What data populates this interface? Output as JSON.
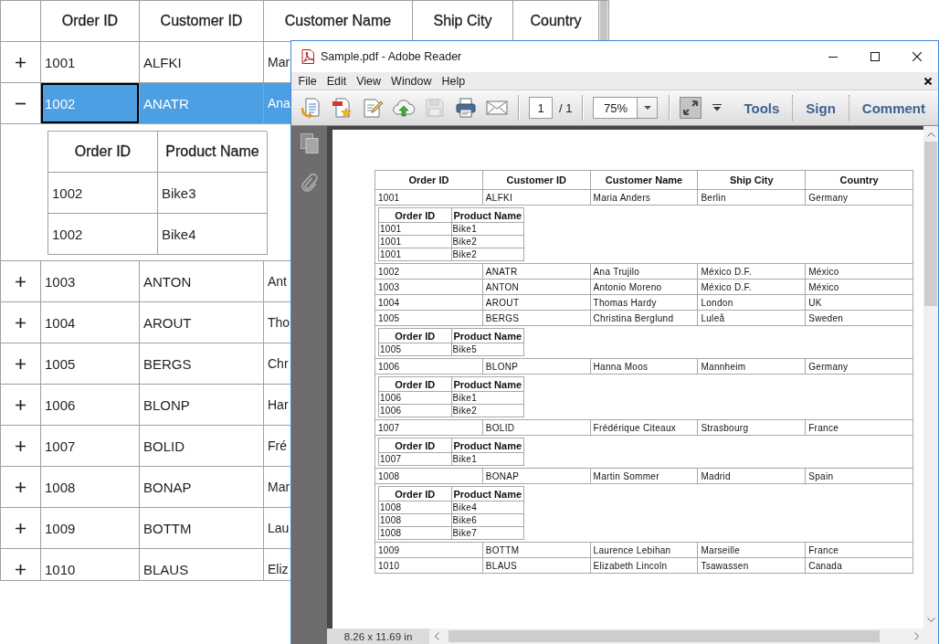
{
  "grid": {
    "columns": [
      "Order ID",
      "Customer ID",
      "Customer Name",
      "Ship City",
      "Country"
    ],
    "rows": [
      {
        "expanded": false,
        "selected": false,
        "cells": [
          {
            "text": "1001",
            "focused": false
          },
          {
            "text": "ALFKI",
            "focused": false
          },
          {
            "text": "Mar",
            "focused": false
          }
        ]
      },
      {
        "expanded": true,
        "selected": true,
        "cells": [
          {
            "text": "1002",
            "focused": true
          },
          {
            "text": "ANATR",
            "focused": false
          },
          {
            "text": "Ana",
            "focused": false
          }
        ],
        "details": {
          "columns": [
            "Order ID",
            "Product Name"
          ],
          "rows": [
            [
              "1002",
              "Bike3"
            ],
            [
              "1002",
              "Bike4"
            ]
          ]
        }
      },
      {
        "expanded": false,
        "selected": false,
        "cells": [
          {
            "text": "1003",
            "focused": false
          },
          {
            "text": "ANTON",
            "focused": false
          },
          {
            "text": "Ant",
            "focused": false
          }
        ]
      },
      {
        "expanded": false,
        "selected": false,
        "cells": [
          {
            "text": "1004",
            "focused": false
          },
          {
            "text": "AROUT",
            "focused": false
          },
          {
            "text": "Tho",
            "focused": false
          }
        ]
      },
      {
        "expanded": false,
        "selected": false,
        "cells": [
          {
            "text": "1005",
            "focused": false
          },
          {
            "text": "BERGS",
            "focused": false
          },
          {
            "text": "Chr",
            "focused": false
          }
        ]
      },
      {
        "expanded": false,
        "selected": false,
        "cells": [
          {
            "text": "1006",
            "focused": false
          },
          {
            "text": "BLONP",
            "focused": false
          },
          {
            "text": "Har",
            "focused": false
          }
        ]
      },
      {
        "expanded": false,
        "selected": false,
        "cells": [
          {
            "text": "1007",
            "focused": false
          },
          {
            "text": "BOLID",
            "focused": false
          },
          {
            "text": "Fré",
            "focused": false
          }
        ]
      },
      {
        "expanded": false,
        "selected": false,
        "cells": [
          {
            "text": "1008",
            "focused": false
          },
          {
            "text": "BONAP",
            "focused": false
          },
          {
            "text": "Mar",
            "focused": false
          }
        ]
      },
      {
        "expanded": false,
        "selected": false,
        "cells": [
          {
            "text": "1009",
            "focused": false
          },
          {
            "text": "BOTTM",
            "focused": false
          },
          {
            "text": "Lau",
            "focused": false
          }
        ]
      },
      {
        "expanded": false,
        "selected": false,
        "cells": [
          {
            "text": "1010",
            "focused": false
          },
          {
            "text": "BLAUS",
            "focused": false
          },
          {
            "text": "Eliz",
            "focused": false
          }
        ]
      }
    ]
  },
  "reader": {
    "title": "Sample.pdf - Adobe Reader",
    "menu": [
      "File",
      "Edit",
      "View",
      "Window",
      "Help"
    ],
    "toolbar": {
      "buttons": [
        {
          "kind": "open",
          "disabled": false
        },
        {
          "kind": "create",
          "disabled": false
        },
        {
          "kind": "edit",
          "disabled": false
        },
        {
          "kind": "upload",
          "disabled": false
        },
        {
          "kind": "save",
          "disabled": true
        },
        {
          "kind": "print",
          "disabled": false
        },
        {
          "kind": "email",
          "disabled": false
        }
      ],
      "page": "1",
      "page_total": "/ 1",
      "zoom": "75%",
      "panes": [
        "Tools",
        "Sign",
        "Comment"
      ]
    },
    "document": {
      "columns": [
        "Order ID",
        "Customer ID",
        "Customer Name",
        "Ship City",
        "Country"
      ],
      "rows": [
        {
          "cells": [
            "1001",
            "ALFKI",
            "Maria Anders",
            "Berlin",
            "Germany"
          ],
          "details": {
            "columns": [
              "Order ID",
              "Product Name"
            ],
            "rows": [
              [
                "1001",
                "Bike1"
              ],
              [
                "1001",
                "Bike2"
              ],
              [
                "1001",
                "Bike2"
              ]
            ]
          }
        },
        {
          "cells": [
            "1002",
            "ANATR",
            "Ana Trujilo",
            "México D.F.",
            "México"
          ]
        },
        {
          "cells": [
            "1003",
            "ANTON",
            "Antonio Moreno",
            "México D.F.",
            "México"
          ]
        },
        {
          "cells": [
            "1004",
            "AROUT",
            "Thomas Hardy",
            "London",
            "UK"
          ]
        },
        {
          "cells": [
            "1005",
            "BERGS",
            "Christina Berglund",
            "Luleå",
            "Sweden"
          ],
          "details": {
            "columns": [
              "Order ID",
              "Product Name"
            ],
            "rows": [
              [
                "1005",
                "Bike5"
              ]
            ]
          }
        },
        {
          "cells": [
            "1006",
            "BLONP",
            "Hanna Moos",
            "Mannheim",
            "Germany"
          ],
          "details": {
            "columns": [
              "Order ID",
              "Product Name"
            ],
            "rows": [
              [
                "1006",
                "Bike1"
              ],
              [
                "1006",
                "Bike2"
              ]
            ]
          }
        },
        {
          "cells": [
            "1007",
            "BOLID",
            "Frédérique Citeaux",
            "Strasbourg",
            "France"
          ],
          "details": {
            "columns": [
              "Order ID",
              "Product Name"
            ],
            "rows": [
              [
                "1007",
                "Bike1"
              ]
            ]
          }
        },
        {
          "cells": [
            "1008",
            "BONAP",
            "Martin Sommer",
            "Madrid",
            "Spain"
          ],
          "details": {
            "columns": [
              "Order ID",
              "Product Name"
            ],
            "rows": [
              [
                "1008",
                "Bike4"
              ],
              [
                "1008",
                "Bike6"
              ],
              [
                "1008",
                "Bike7"
              ]
            ]
          }
        },
        {
          "cells": [
            "1009",
            "BOTTM",
            "Laurence Lebihan",
            "Marseille",
            "France"
          ]
        },
        {
          "cells": [
            "1010",
            "BLAUS",
            "Elizabeth Lincoln",
            "Tsawassen",
            "Canada"
          ]
        }
      ]
    },
    "page_size": "8.26 x 11.69 in"
  }
}
